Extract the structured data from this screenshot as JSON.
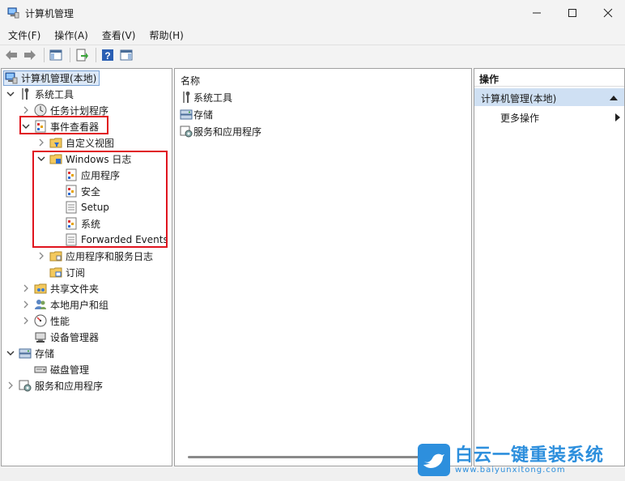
{
  "window": {
    "title": "计算机管理"
  },
  "menu": [
    "文件(F)",
    "操作(A)",
    "查看(V)",
    "帮助(H)"
  ],
  "tree": {
    "root": "计算机管理(本地)",
    "system_tools": "系统工具",
    "task_scheduler": "任务计划程序",
    "event_viewer": "事件查看器",
    "custom_views": "自定义视图",
    "windows_logs": "Windows 日志",
    "application": "应用程序",
    "security": "安全",
    "setup": "Setup",
    "system": "系统",
    "forwarded_events": "Forwarded Events",
    "app_service_logs": "应用程序和服务日志",
    "subscriptions": "订阅",
    "shared_folders": "共享文件夹",
    "local_users_groups": "本地用户和组",
    "performance": "性能",
    "device_manager": "设备管理器",
    "storage": "存储",
    "disk_management": "磁盘管理",
    "services_apps": "服务和应用程序"
  },
  "list": {
    "header": "名称",
    "items": [
      "系统工具",
      "存储",
      "服务和应用程序"
    ]
  },
  "actions": {
    "title": "操作",
    "section": "计算机管理(本地)",
    "more": "更多操作"
  },
  "watermark": {
    "title": "白云一键重装系统",
    "url": "www.baiyunxitong.com"
  }
}
